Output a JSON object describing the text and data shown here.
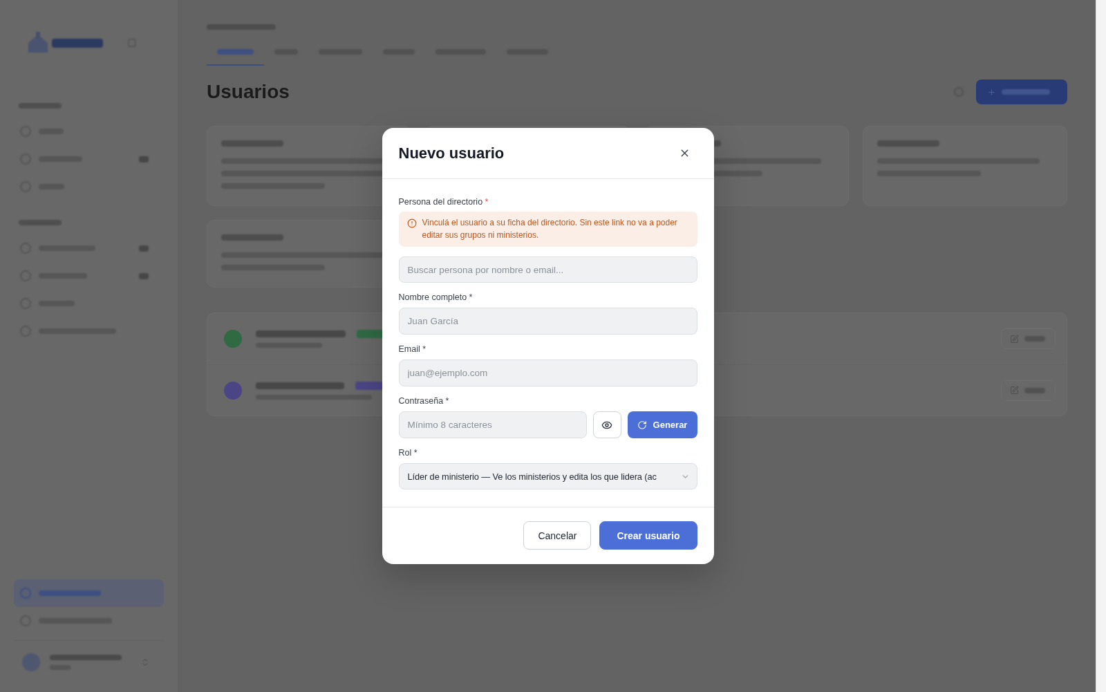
{
  "sidebar": {
    "sections": [
      {
        "items": [
          {
            "kind": "plain",
            "selected": false
          },
          {
            "kind": "counted",
            "selected": false
          },
          {
            "kind": "plain",
            "selected": false
          }
        ]
      },
      {
        "items": [
          {
            "kind": "counted",
            "selected": false
          },
          {
            "kind": "counted",
            "selected": false
          },
          {
            "kind": "plain",
            "selected": false
          },
          {
            "kind": "plain",
            "selected": false
          }
        ]
      }
    ],
    "footer_items": [
      {
        "kind": "plain",
        "selected": true
      },
      {
        "kind": "plain",
        "selected": false
      }
    ]
  },
  "page": {
    "tabs": [
      {
        "selected": true
      },
      {
        "selected": false
      },
      {
        "selected": false
      },
      {
        "selected": false
      },
      {
        "selected": false
      },
      {
        "selected": false
      }
    ],
    "title": "Usuarios",
    "users": [
      {
        "color": "#2f6a43"
      },
      {
        "color": "#4c4585"
      }
    ]
  },
  "dialog": {
    "title": "Nuevo usuario",
    "fields": [
      {
        "kind": "directory",
        "label": "Persona del directorio",
        "required_mark": "*",
        "alert": "Vinculá el usuario a su ficha del directorio. Sin este link no va a poder editar sus grupos ni ministerios.",
        "placeholder": "Buscar persona por nombre o email..."
      },
      {
        "kind": "text",
        "label": "Nombre completo *",
        "placeholder": "Juan García"
      },
      {
        "kind": "text",
        "label": "Email *",
        "placeholder": "juan@ejemplo.com"
      },
      {
        "kind": "password",
        "label": "Contraseña *",
        "placeholder": "Mínimo 8 caracteres",
        "action": "Generar"
      },
      {
        "kind": "select",
        "label": "Rol *",
        "value": "Líder de ministerio — Ve los ministerios y edita los que lidera (ac"
      }
    ],
    "buttons": [
      {
        "kind": "secondary",
        "label": "Cancelar"
      },
      {
        "kind": "primary",
        "label": "Crear usuario"
      }
    ]
  }
}
